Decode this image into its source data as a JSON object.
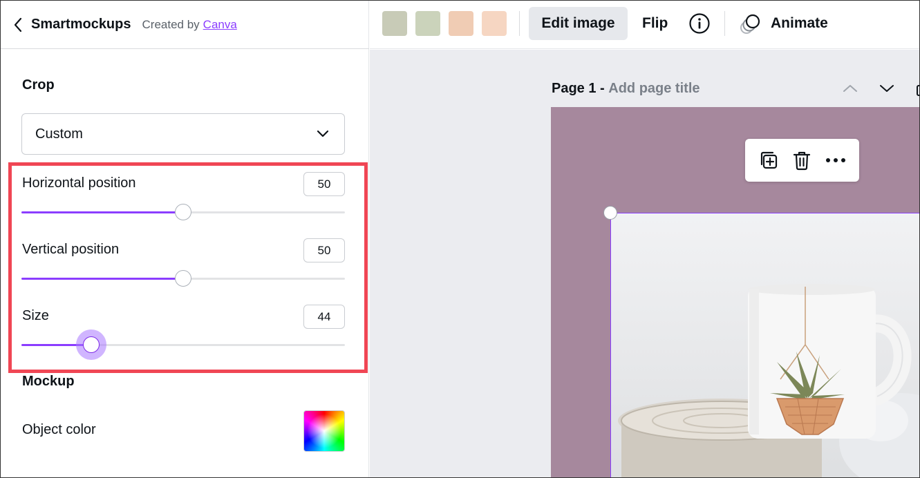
{
  "panel": {
    "title": "Smartmockups",
    "created_by": "Created by",
    "creator_link": "Canva",
    "crop": {
      "label": "Crop",
      "dropdown_value": "Custom"
    },
    "sliders": [
      {
        "label": "Horizontal position",
        "value": "50",
        "fraction": 0.5
      },
      {
        "label": "Vertical position",
        "value": "50",
        "fraction": 0.5
      },
      {
        "label": "Size",
        "value": "44",
        "fraction": 0.215
      }
    ],
    "mockup": {
      "label": "Mockup",
      "object_color_label": "Object color"
    }
  },
  "toolbar": {
    "swatches": [
      "#c8cbb7",
      "#cbd3bb",
      "#f0ccb4",
      "#f6d6c2"
    ],
    "edit_image": "Edit image",
    "flip": "Flip",
    "animate": "Animate"
  },
  "canvas": {
    "page_number": "Page 1 -",
    "page_title_placeholder": "Add page title",
    "page_bg": "#a6889d"
  },
  "colors": {
    "accent": "#8b3dff",
    "highlight": "#f04654"
  }
}
